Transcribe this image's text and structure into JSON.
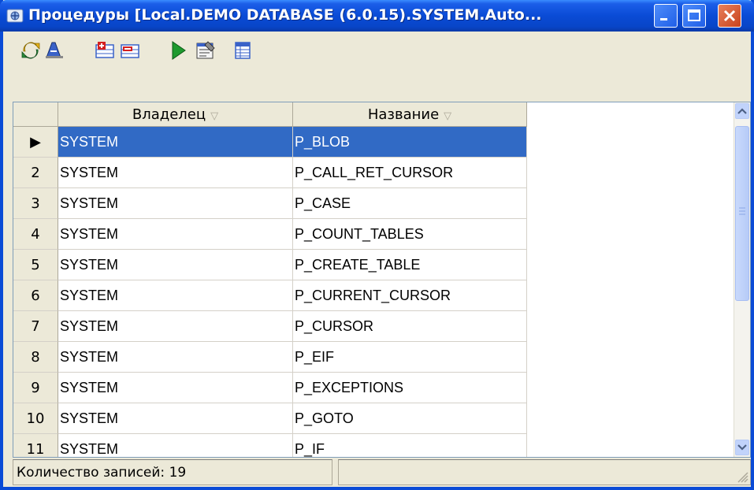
{
  "window": {
    "title": "Процедуры [Local.DEMO DATABASE (6.0.15).SYSTEM.Auto..."
  },
  "toolbar": {
    "buttons": [
      {
        "icon": "refresh-icon"
      },
      {
        "icon": "find-icon"
      },
      {
        "icon": "add-icon"
      },
      {
        "icon": "delete-icon"
      },
      {
        "icon": "run-icon"
      },
      {
        "icon": "properties-icon"
      },
      {
        "icon": "grid-view-icon"
      }
    ]
  },
  "grid": {
    "columns": [
      "Владелец",
      "Название"
    ],
    "sort_glyph": "▽",
    "current_row_marker": "▶",
    "rows": [
      {
        "num": "",
        "owner": "SYSTEM",
        "name": "P_BLOB",
        "selected": true
      },
      {
        "num": "2",
        "owner": "SYSTEM",
        "name": "P_CALL_RET_CURSOR"
      },
      {
        "num": "3",
        "owner": "SYSTEM",
        "name": "P_CASE"
      },
      {
        "num": "4",
        "owner": "SYSTEM",
        "name": "P_COUNT_TABLES"
      },
      {
        "num": "5",
        "owner": "SYSTEM",
        "name": "P_CREATE_TABLE"
      },
      {
        "num": "6",
        "owner": "SYSTEM",
        "name": "P_CURRENT_CURSOR"
      },
      {
        "num": "7",
        "owner": "SYSTEM",
        "name": "P_CURSOR"
      },
      {
        "num": "8",
        "owner": "SYSTEM",
        "name": "P_EIF"
      },
      {
        "num": "9",
        "owner": "SYSTEM",
        "name": "P_EXCEPTIONS"
      },
      {
        "num": "10",
        "owner": "SYSTEM",
        "name": "P_GOTO"
      },
      {
        "num": "11",
        "owner": "SYSTEM",
        "name": "P_IF"
      }
    ]
  },
  "status": {
    "records": "Количество записей: 19"
  },
  "colors": {
    "titlebar": "#0a4bd6",
    "selection": "#316ac5",
    "chrome": "#ece9d8"
  }
}
